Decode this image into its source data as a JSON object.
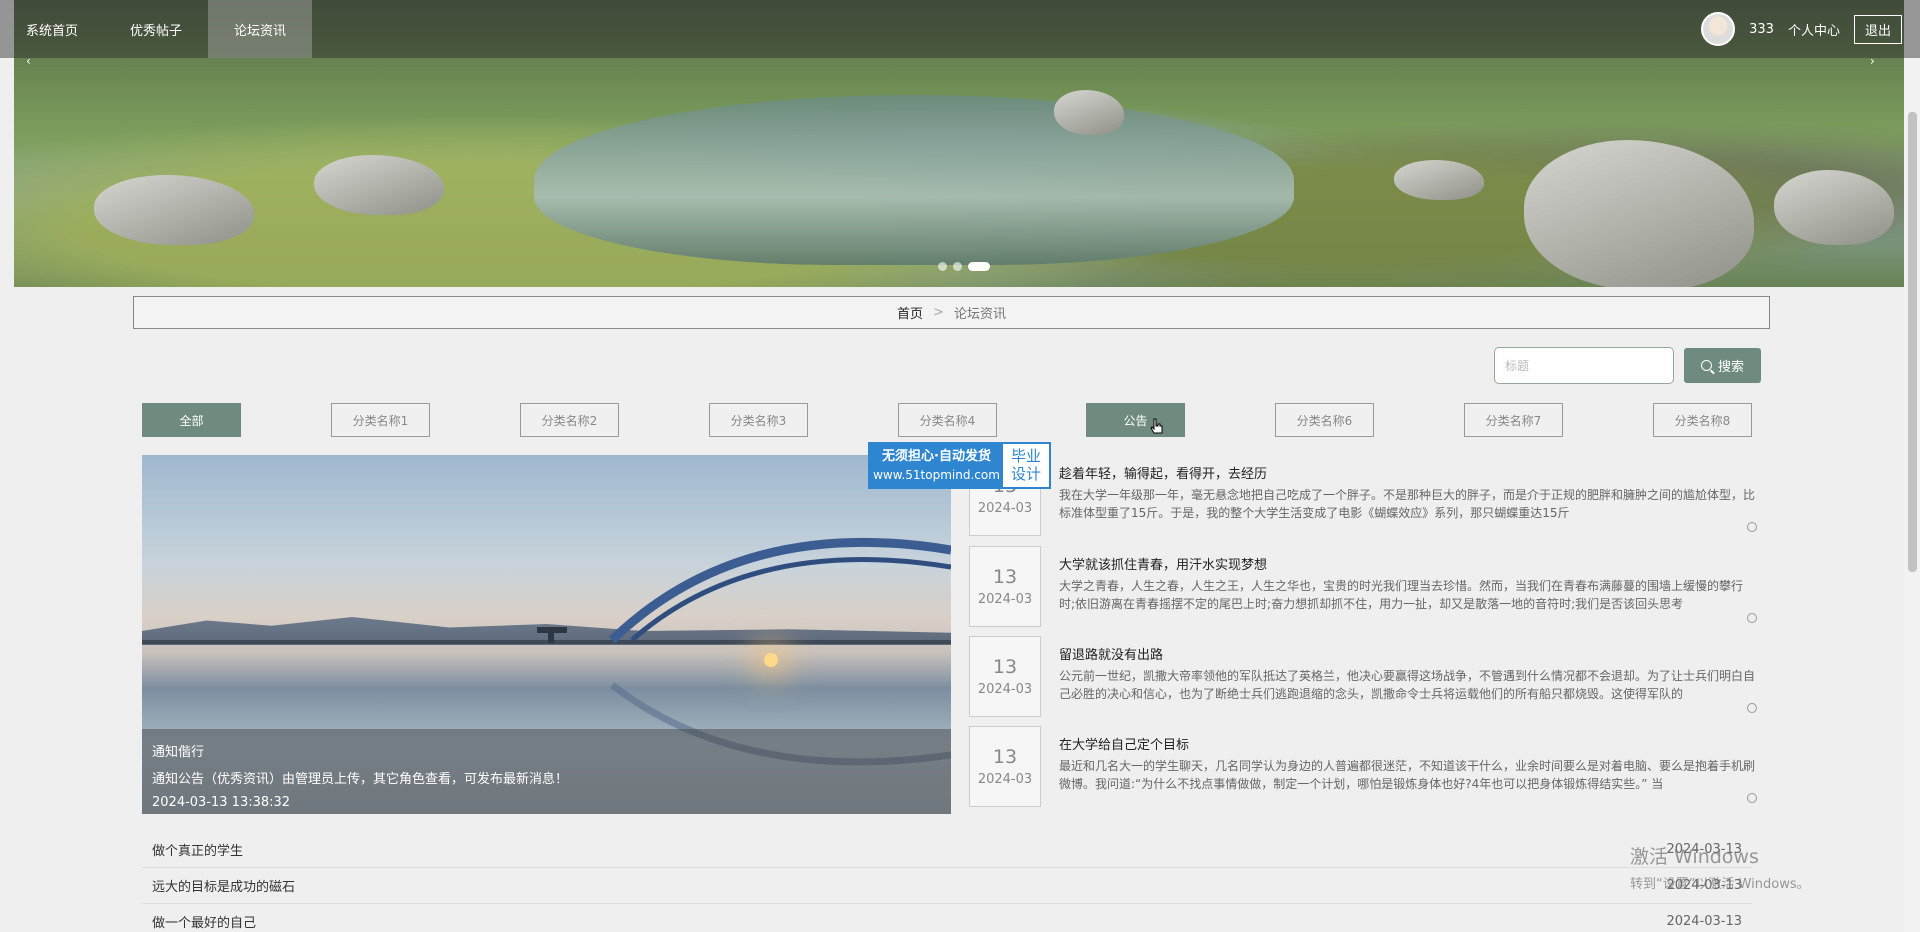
{
  "nav": {
    "items": [
      "系统首页",
      "优秀帖子",
      "论坛资讯"
    ],
    "active_index": 2,
    "username": "333",
    "personal_center": "个人中心",
    "logout": "退出"
  },
  "banner": {
    "slides": 3,
    "active_slide": 3
  },
  "breadcrumb": {
    "home": "首页",
    "separator": ">",
    "current": "论坛资讯"
  },
  "search": {
    "placeholder": "标题",
    "button": "搜索"
  },
  "tabs": [
    {
      "label": "全部",
      "state": "active"
    },
    {
      "label": "分类名称1",
      "state": "normal"
    },
    {
      "label": "分类名称2",
      "state": "normal"
    },
    {
      "label": "分类名称3",
      "state": "normal"
    },
    {
      "label": "分类名称4",
      "state": "normal"
    },
    {
      "label": "公告",
      "state": "hover"
    },
    {
      "label": "分类名称6",
      "state": "normal"
    },
    {
      "label": "分类名称7",
      "state": "normal"
    },
    {
      "label": "分类名称8",
      "state": "normal"
    }
  ],
  "featured": {
    "title": "通知偕行",
    "desc": "通知公告（优秀资讯）由管理员上传，其它角色查看，可发布最新消息！",
    "time": "2024-03-13 13:38:32"
  },
  "badge": {
    "line1": "无须担心·自动发货",
    "line2": "www.51topmind.com",
    "right1": "毕业",
    "right2": "设计"
  },
  "news": [
    {
      "day": "13",
      "ym": "2024-03",
      "title": "趁着年轻，输得起，看得开，去经历",
      "body": "我在大学一年级那一年，毫无悬念地把自己吃成了一个胖子。不是那种巨大的胖子，而是介于正规的肥胖和臃肿之间的尴尬体型，比标准体型重了15斤。于是，我的整个大学生活变成了电影《蝴蝶效应》系列，那只蝴蝶重达15斤"
    },
    {
      "day": "13",
      "ym": "2024-03",
      "title": "大学就该抓住青春，用汗水实现梦想",
      "body": "大学之青春，人生之春，人生之王，人生之华也，宝贵的时光我们理当去珍惜。然而，当我们在青春布满藤蔓的围墙上缓慢的攀行时;依旧游离在青春摇摆不定的尾巴上时;奋力想抓却抓不住，用力一扯，却又是散落一地的音符时;我们是否该回头思考"
    },
    {
      "day": "13",
      "ym": "2024-03",
      "title": "留退路就没有出路",
      "body": "公元前一世纪，凯撒大帝率领他的军队抵达了英格兰，他决心要赢得这场战争，不管遇到什么情况都不会退却。为了让士兵们明白自己必胜的决心和信心，也为了断绝士兵们逃跑退缩的念头，凯撒命令士兵将运载他们的所有船只都烧毁。这使得军队的"
    },
    {
      "day": "13",
      "ym": "2024-03",
      "title": "在大学给自己定个目标",
      "body": "最近和几名大一的学生聊天，几名同学认为身边的人普遍都很迷茫，不知道该干什么，业余时间要么是对着电脑、要么是抱着手机刷微博。我问道:“为什么不找点事情做做，制定一个计划，哪怕是锻炼身体也好?4年也可以把身体锻炼得结实些。” 当"
    }
  ],
  "bottom_list": [
    {
      "title": "做个真正的学生",
      "date": "2024-03-13"
    },
    {
      "title": "远大的目标是成功的磁石",
      "date": "2024-03-13"
    },
    {
      "title": "做一个最好的自己",
      "date": "2024-03-13"
    }
  ],
  "activation": {
    "line1": "激活 Windows",
    "line2": "转到“设置”以激活 Windows。"
  }
}
